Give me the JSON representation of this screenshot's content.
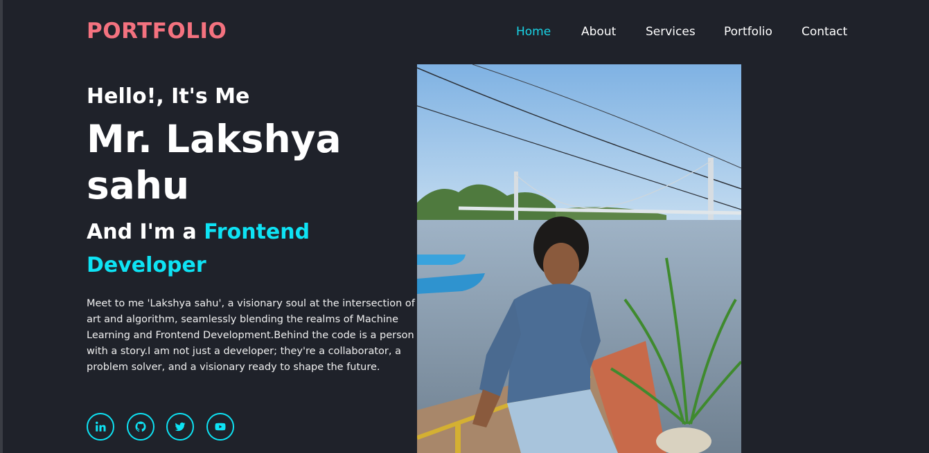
{
  "header": {
    "logo": "PORTFOLIO",
    "nav": [
      {
        "label": "Home",
        "active": true
      },
      {
        "label": "About",
        "active": false
      },
      {
        "label": "Services",
        "active": false
      },
      {
        "label": "Portfolio",
        "active": false
      },
      {
        "label": "Contact",
        "active": false
      }
    ]
  },
  "hero": {
    "greeting": "Hello!, It's Me",
    "name": "Mr. Lakshya sahu",
    "role_prefix": "And I'm a ",
    "role_highlight": "Frontend Developer",
    "description": "Meet to me 'Lakshya sahu', a visionary soul at the intersection of art and algorithm, seamlessly blending the realms of Machine Learning and Frontend Development.Behind the code is a person with a story.I am not just a developer; they're a collaborator, a problem solver, and a visionary ready to shape the future."
  },
  "socials": [
    {
      "icon": "linkedin-icon"
    },
    {
      "icon": "github-icon"
    },
    {
      "icon": "twitter-icon"
    },
    {
      "icon": "youtube-icon"
    }
  ],
  "colors": {
    "background": "#1f222a",
    "logo": "#f4727f",
    "accent": "#0ee3f4",
    "nav_active": "#19d4e6"
  }
}
